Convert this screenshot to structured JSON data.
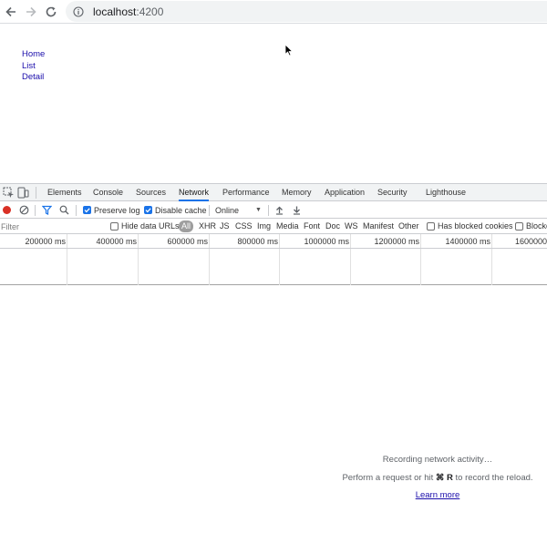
{
  "browser": {
    "url_host": "localhost",
    "url_port": ":4200",
    "icons": [
      "back-arrow-icon",
      "forward-arrow-icon",
      "reload-icon",
      "info-icon"
    ]
  },
  "page": {
    "links": [
      "Home",
      "List",
      "Detail"
    ]
  },
  "devtools": {
    "tabs": [
      "Elements",
      "Console",
      "Sources",
      "Network",
      "Performance",
      "Memory",
      "Application",
      "Security",
      "Lighthouse"
    ],
    "active_tab": "Network",
    "toolbar": {
      "preserve_log_label": "Preserve log",
      "preserve_log_checked": true,
      "disable_cache_label": "Disable cache",
      "disable_cache_checked": true,
      "throttling_value": "Online"
    },
    "filter": {
      "placeholder": "Filter",
      "hide_data_urls_label": "Hide data URLs",
      "types": [
        "All",
        "XHR",
        "JS",
        "CSS",
        "Img",
        "Media",
        "Font",
        "Doc",
        "WS",
        "Manifest",
        "Other"
      ],
      "selected_type": "All",
      "has_blocked_cookies_label": "Has blocked cookies",
      "blocked_requests_label": "Blocke"
    },
    "timeline_ticks": [
      "200000 ms",
      "400000 ms",
      "600000 ms",
      "800000 ms",
      "1000000 ms",
      "1200000 ms",
      "1400000 ms",
      "1600000"
    ],
    "empty_state": {
      "line1": "Recording network activity…",
      "line2_prefix": "Perform a request or hit ",
      "line2_keys": "⌘ R",
      "line2_suffix": " to record the reload.",
      "learn_more": "Learn more"
    },
    "colors": {
      "record_active": "#d93025",
      "accent": "#1a73e8"
    }
  }
}
